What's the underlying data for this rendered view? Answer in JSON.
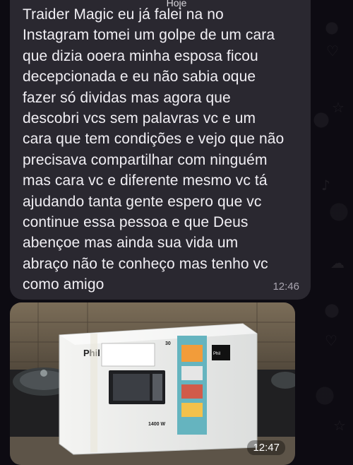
{
  "date_chip": "Hoje",
  "messages": [
    {
      "type": "text",
      "body": "Traider Magic eu já falei na no\nInstagram tomei um golpe de um cara\nque dizia ooera minha esposa ficou\ndecepcionada e eu não sabia oque\nfazer só dividas mas agora que\ndescobri vcs sem palavras vc e um\ncara que tem condições e vejo que não\nprecisava compartilhar com ninguém\nmas cara vc e diferente mesmo vc tá\najudando tanta gente espero que vc\ncontinue essa pessoa e que Deus\nabençoe mas ainda sua vida um\nabraço não te conheço mas tenho vc\ncomo amigo",
      "time": "12:46"
    },
    {
      "type": "photo",
      "photo": {
        "brand": "Phil",
        "box_number": "30",
        "power_label": "1400 W",
        "brand_small": "Phil"
      },
      "time": "12:47"
    }
  ]
}
